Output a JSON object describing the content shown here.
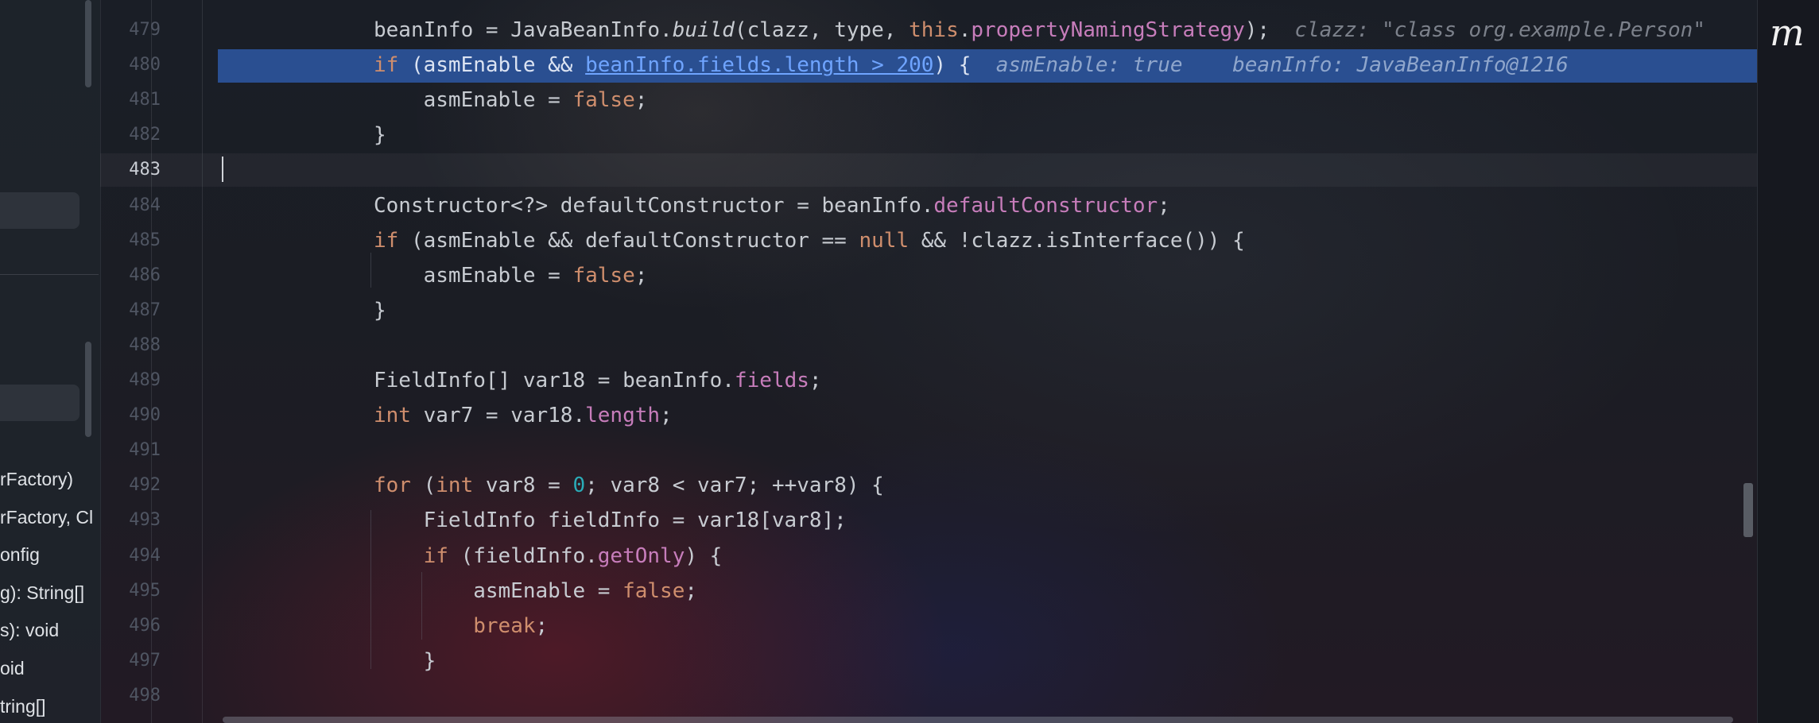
{
  "app": {
    "logo_glyph": "m"
  },
  "structure_panel": {
    "items": [
      "rFactory)",
      "rFactory, Cl",
      "onfig",
      "g): String[]",
      "s): void",
      "oid",
      "tring[]"
    ]
  },
  "editor": {
    "active_line": 483,
    "highlighted_line": 480,
    "lines": [
      {
        "no": 479,
        "tokens": [
          {
            "t": "beanInfo = JavaBeanInfo."
          },
          {
            "t": "build",
            "c": "ital"
          },
          {
            "t": "(clazz, type, "
          },
          {
            "t": "this",
            "c": "kw"
          },
          {
            "t": "."
          },
          {
            "t": "propertyNamingStrategy",
            "c": "fld"
          },
          {
            "t": ");  "
          },
          {
            "t": "clazz: \"class org.example.Person\"",
            "c": "hint"
          }
        ]
      },
      {
        "no": 480,
        "tokens": [
          {
            "t": "if",
            "c": "kw"
          },
          {
            "t": " (asmEnable && "
          },
          {
            "t": "beanInfo.fields.length > 200",
            "c": "link"
          },
          {
            "t": ") {  "
          },
          {
            "t": "asmEnable: true    beanInfo: JavaBeanInfo@1216",
            "c": "hint-hl"
          }
        ]
      },
      {
        "no": 481,
        "tokens": [
          {
            "t": "    asmEnable = "
          },
          {
            "t": "false",
            "c": "kw"
          },
          {
            "t": ";"
          }
        ]
      },
      {
        "no": 482,
        "tokens": [
          {
            "t": "}"
          }
        ]
      },
      {
        "no": 483,
        "tokens": []
      },
      {
        "no": 484,
        "tokens": [
          {
            "t": "Constructor<?> defaultConstructor = beanInfo."
          },
          {
            "t": "defaultConstructor",
            "c": "fld"
          },
          {
            "t": ";"
          }
        ]
      },
      {
        "no": 485,
        "tokens": [
          {
            "t": "if",
            "c": "kw"
          },
          {
            "t": " (asmEnable && defaultConstructor == "
          },
          {
            "t": "null",
            "c": "kw"
          },
          {
            "t": " && !clazz.isInterface()) {"
          }
        ]
      },
      {
        "no": 486,
        "tokens": [
          {
            "t": "    asmEnable = "
          },
          {
            "t": "false",
            "c": "kw"
          },
          {
            "t": ";"
          }
        ]
      },
      {
        "no": 487,
        "tokens": [
          {
            "t": "}"
          }
        ]
      },
      {
        "no": 488,
        "tokens": []
      },
      {
        "no": 489,
        "tokens": [
          {
            "t": "FieldInfo[] var18 = beanInfo."
          },
          {
            "t": "fields",
            "c": "fld"
          },
          {
            "t": ";"
          }
        ]
      },
      {
        "no": 490,
        "tokens": [
          {
            "t": "int",
            "c": "kw"
          },
          {
            "t": " var7 = var18."
          },
          {
            "t": "length",
            "c": "fld"
          },
          {
            "t": ";"
          }
        ]
      },
      {
        "no": 491,
        "tokens": []
      },
      {
        "no": 492,
        "tokens": [
          {
            "t": "for",
            "c": "kw"
          },
          {
            "t": " ("
          },
          {
            "t": "int",
            "c": "kw"
          },
          {
            "t": " var8 = "
          },
          {
            "t": "0",
            "c": "num"
          },
          {
            "t": "; var8 < var7; ++var8) {"
          }
        ]
      },
      {
        "no": 493,
        "tokens": [
          {
            "t": "    FieldInfo fieldInfo = var18[var8];"
          }
        ]
      },
      {
        "no": 494,
        "tokens": [
          {
            "t": "    "
          },
          {
            "t": "if",
            "c": "kw"
          },
          {
            "t": " (fieldInfo."
          },
          {
            "t": "getOnly",
            "c": "fld"
          },
          {
            "t": ") {"
          }
        ]
      },
      {
        "no": 495,
        "tokens": [
          {
            "t": "        asmEnable = "
          },
          {
            "t": "false",
            "c": "kw"
          },
          {
            "t": ";"
          }
        ]
      },
      {
        "no": 496,
        "tokens": [
          {
            "t": "        "
          },
          {
            "t": "break",
            "c": "kw"
          },
          {
            "t": ";"
          }
        ]
      },
      {
        "no": 497,
        "tokens": [
          {
            "t": "    }"
          }
        ]
      },
      {
        "no": 498,
        "tokens": []
      }
    ]
  }
}
